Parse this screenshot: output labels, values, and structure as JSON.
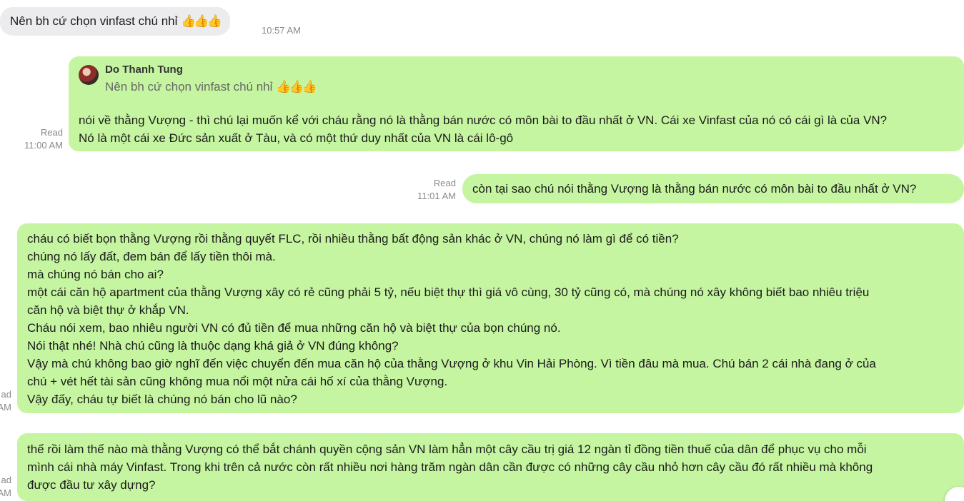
{
  "messages": [
    {
      "direction": "incoming",
      "text": "Nên bh cứ chọn vinfast chú nhỉ",
      "reaction": "👍👍👍",
      "time": "10:57 AM"
    },
    {
      "direction": "outgoing",
      "quote": {
        "author": "Do Thanh Tung",
        "text": "Nên bh cứ chọn vinfast chú nhỉ",
        "reaction": "👍👍👍"
      },
      "text": "nói về thằng Vượng - thì chú lại muốn kể với cháu rằng nó là thằng bán nước có môn bài to đầu nhất ở VN. Cái xe Vinfast của nó có cái gì là của VN?\nNó là một cái xe Đức sản xuất ở Tàu, và có một thứ duy nhất của VN là cái lô-gô",
      "status": "Read",
      "time": "11:00 AM"
    },
    {
      "direction": "outgoing",
      "text": "còn tại sao chú nói thằng Vượng là thằng bán nước có môn bài to đầu nhất ở VN?",
      "status": "Read",
      "time": "11:01 AM"
    },
    {
      "direction": "outgoing",
      "text": "cháu có biết bọn thằng Vượng rồi thằng quyết FLC, rồi nhiều thằng bất động sản khác ở VN, chúng nó làm gì để có tiền?\nchúng nó lấy đất, đem bán để lấy tiền thôi mà.\nmà chúng nó bán cho ai?\nmột cái căn hộ apartment của thằng Vượng xây có rẻ cũng phải 5 tỷ, nếu biệt thự thì giá vô cùng, 30 tỷ cũng có, mà chúng nó xây không biết bao nhiêu triệu\ncăn hộ và biệt thự ở khắp VN.\nCháu nói xem, bao nhiêu người VN có đủ tiền để mua những căn hộ và biệt thự của bọn chúng nó.\nNói thật nhé! Nhà chú cũng là thuộc dạng khá giả ở VN đúng không?\nVậy mà chú không bao giờ nghĩ đến việc chuyển đến mua căn hộ của thằng Vượng ở khu Vin Hải Phòng. Vì tiền đâu mà mua. Chú bán 2 cái nhà đang ở của\nchú + vét hết tài sản cũng không mua nổi một nửa cái hố xí của thằng Vượng.\nVậy đấy, cháu tự biết là chúng nó bán cho lũ nào?",
      "status": "ad",
      "time": "AM"
    },
    {
      "direction": "outgoing",
      "text": "thế rồi làm thế nào mà thằng Vượng có thể bắt chánh quyền cộng sản VN làm hẳn một cây cầu trị giá 12 ngàn tỉ đồng tiền thuế của dân để phục vụ cho mỗi\nmình cái nhà máy Vinfast. Trong khi trên cả nước còn rất nhiều nơi hàng trăm ngàn dân cần được có những cây cầu nhỏ hơn cây cầu đó rất nhiều mà không\nđược đầu tư xây dựng?",
      "status": "ad",
      "time": "AM"
    }
  ],
  "colors": {
    "incoming_bubble": "#ececee",
    "outgoing_bubble": "#c5f5a0",
    "meta_text": "#8a8a8a"
  },
  "icons": {
    "avatar": "user-avatar",
    "reaction": "thumbs-up-icon",
    "scroll": "scroll-down-button"
  }
}
